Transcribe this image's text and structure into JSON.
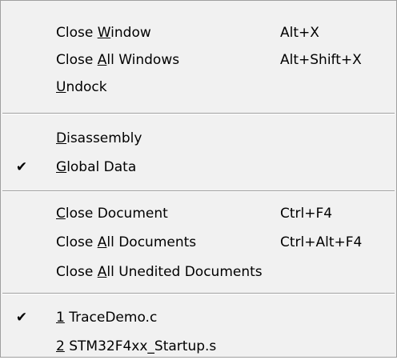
{
  "menu": {
    "items": [
      {
        "mnemonic_pre": "Close ",
        "mnemonic": "W",
        "mnemonic_post": "indow",
        "shortcut": "Alt+X"
      },
      {
        "mnemonic_pre": "Close ",
        "mnemonic": "A",
        "mnemonic_post": "ll Windows",
        "shortcut": "Alt+Shift+X"
      },
      {
        "mnemonic_pre": "",
        "mnemonic": "U",
        "mnemonic_post": "ndock",
        "shortcut": ""
      },
      {
        "mnemonic_pre": "",
        "mnemonic": "D",
        "mnemonic_post": "isassembly",
        "shortcut": "",
        "checked": false
      },
      {
        "mnemonic_pre": "",
        "mnemonic": "G",
        "mnemonic_post": "lobal Data",
        "shortcut": "",
        "checked": true,
        "check_glyph": "✔"
      },
      {
        "mnemonic_pre": "",
        "mnemonic": "C",
        "mnemonic_post": "lose Document",
        "shortcut": "Ctrl+F4"
      },
      {
        "mnemonic_pre": "Close ",
        "mnemonic": "A",
        "mnemonic_post": "ll Documents",
        "shortcut": "Ctrl+Alt+F4"
      },
      {
        "mnemonic_pre": "Close ",
        "mnemonic": "A",
        "mnemonic_post": "ll Unedited Documents",
        "shortcut": ""
      },
      {
        "mnemonic_pre": "",
        "mnemonic": "1",
        "mnemonic_post": " TraceDemo.c",
        "shortcut": "",
        "checked": true,
        "check_glyph": "✔"
      },
      {
        "mnemonic_pre": "",
        "mnemonic": "2",
        "mnemonic_post": " STM32F4xx_Startup.s",
        "shortcut": ""
      }
    ]
  },
  "colors": {
    "menu_background": "#f1f1f1",
    "separator": "#a0a0a0",
    "text": "#000000"
  }
}
